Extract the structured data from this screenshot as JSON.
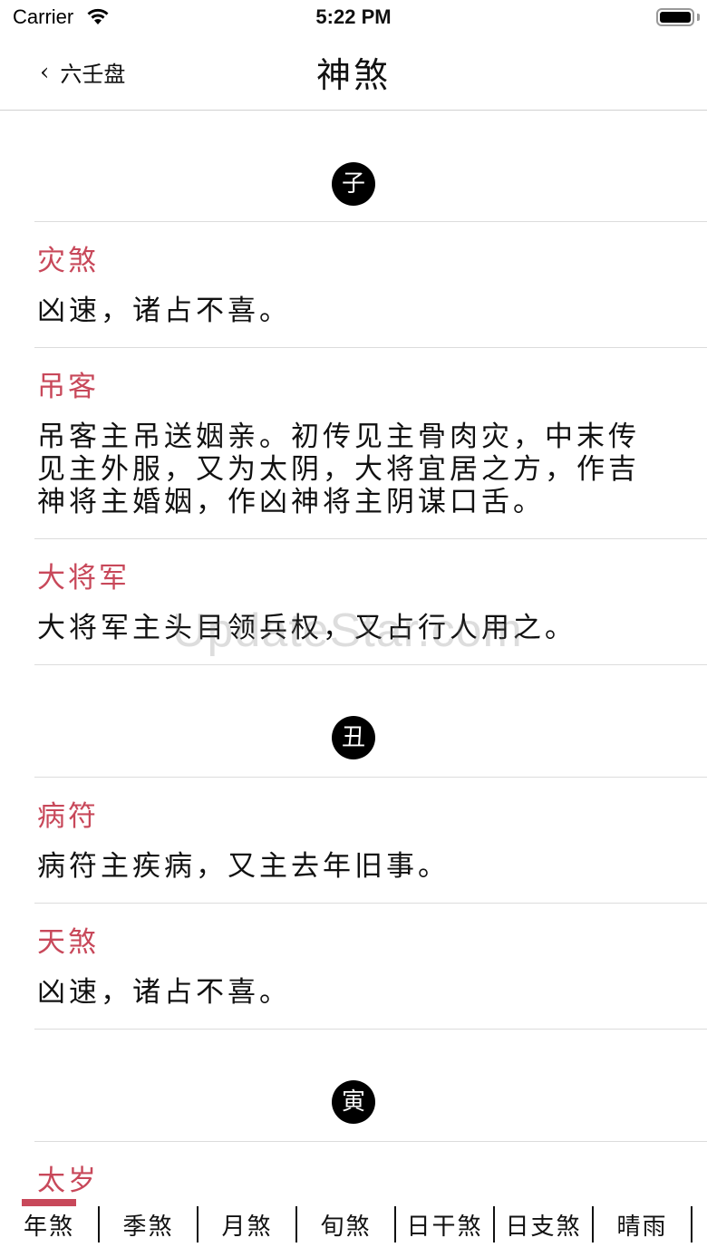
{
  "status_bar": {
    "carrier": "Carrier",
    "time": "5:22 PM"
  },
  "nav": {
    "back_label": "六壬盘",
    "title": "神煞"
  },
  "sections": [
    {
      "branch": "子",
      "entries": [
        {
          "name": "灾煞",
          "desc": "凶速，诸占不喜。"
        },
        {
          "name": "吊客",
          "desc": "吊客主吊送姻亲。初传见主骨肉灾，中末传见主外服，又为太阴，大将宜居之方，作吉神将主婚姻，作凶神将主阴谋口舌。"
        },
        {
          "name": "大将军",
          "desc": "大将军主头目领兵权，又占行人用之。"
        }
      ]
    },
    {
      "branch": "丑",
      "entries": [
        {
          "name": "病符",
          "desc": "病符主疾病，又主去年旧事。"
        },
        {
          "name": "天煞",
          "desc": "凶速，诸占不喜。"
        }
      ]
    },
    {
      "branch": "寅",
      "entries": [
        {
          "name": "太岁",
          "desc": ""
        }
      ]
    }
  ],
  "watermark": "UpdateStar.com",
  "tabs": [
    "年煞",
    "季煞",
    "月煞",
    "旬煞",
    "日干煞",
    "日支煞",
    "晴雨"
  ],
  "colors": {
    "accent": "#c8485a",
    "badge": "#000000"
  }
}
